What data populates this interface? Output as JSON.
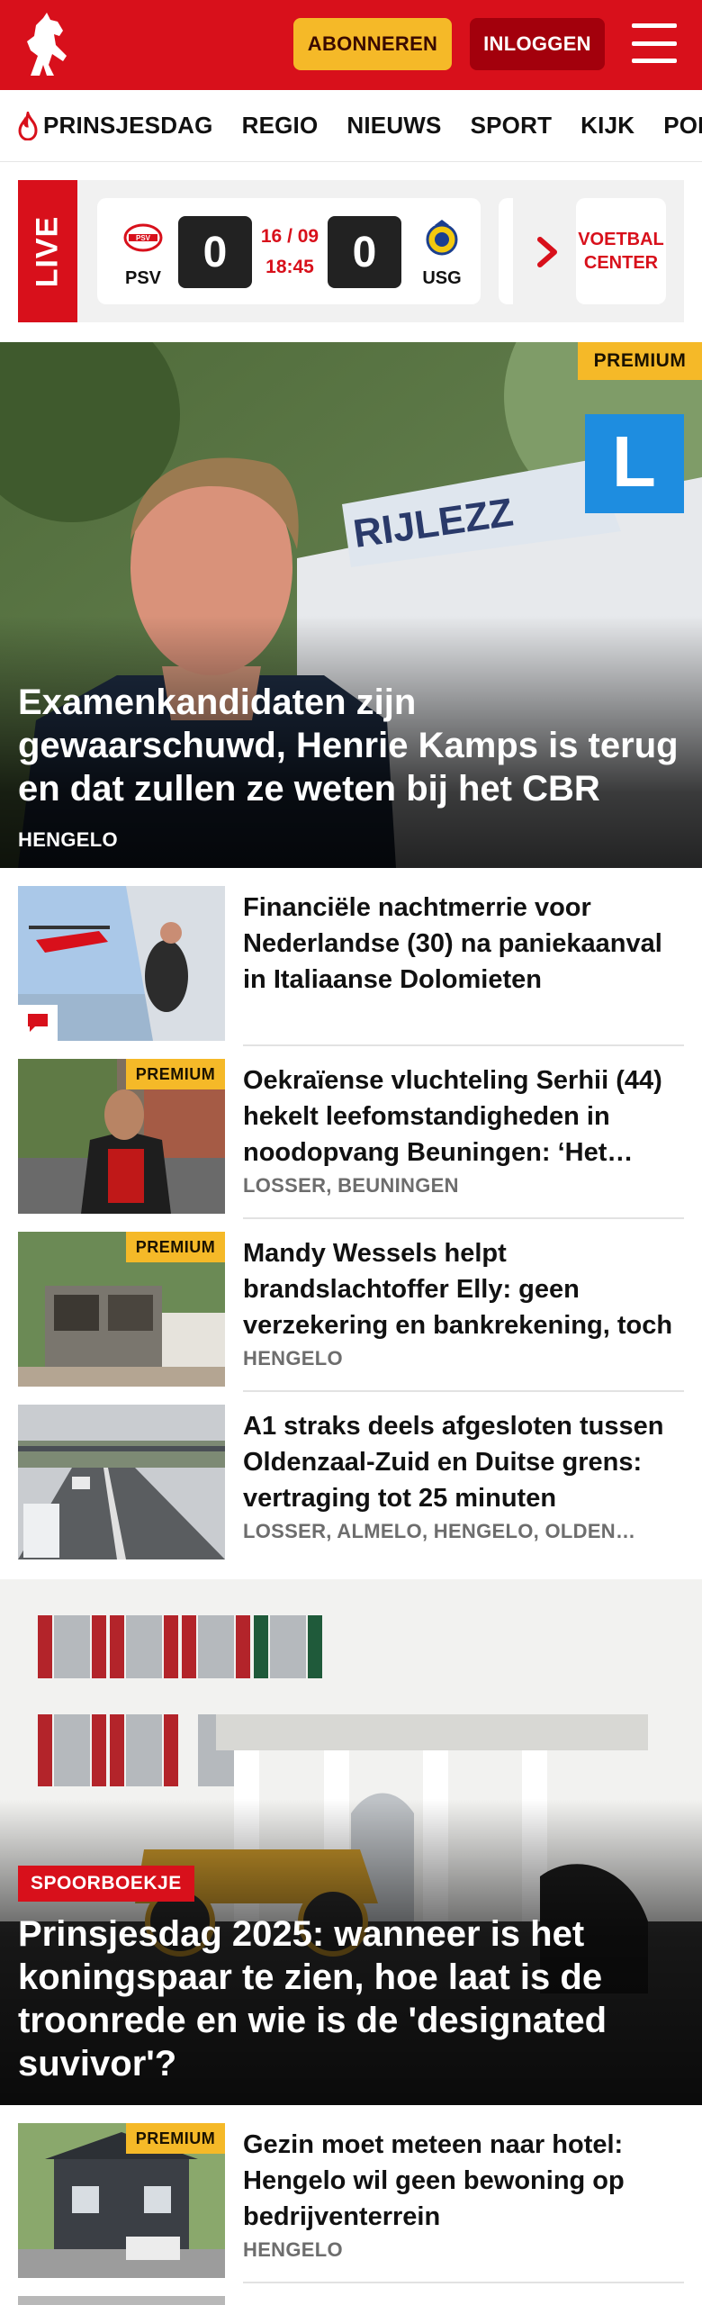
{
  "header": {
    "subscribe_label": "ABONNEREN",
    "login_label": "INLOGGEN"
  },
  "nav": {
    "items": [
      "PRINSJESDAG",
      "REGIO",
      "NIEUWS",
      "SPORT",
      "KIJK",
      "PODCA"
    ]
  },
  "live": {
    "tag": "LIVE",
    "home_team": "PSV",
    "away_team": "USG",
    "home_score": "0",
    "away_score": "0",
    "date": "16 / 09",
    "time": "18:45",
    "voetbal_center": "VOETBAL CENTER"
  },
  "hero": {
    "badge": "PREMIUM",
    "title": "Examenkandidaten zijn gewaarschuwd, Henrie Kamps is terug en dat zullen ze weten bij het CBR",
    "location": "HENGELO",
    "sign_text": "RIJLEZZ"
  },
  "articles": [
    {
      "title": "Financiële nachtmerrie voor Nederlandse (30) na paniekaanval in Italiaanse Dolomieten",
      "location": "",
      "premium": false,
      "comment_icon": true
    },
    {
      "title": "Oekraïense vluchteling Serhii (44) hekelt leefomstandigheden in noodopvang Beuningen: ‘Het…",
      "location": "LOSSER, BEUNINGEN",
      "premium": true,
      "premium_label": "PREMIUM"
    },
    {
      "title": "Mandy Wessels helpt brandslachtoffer Elly: geen verzekering en bankrekening, toch hoo…",
      "location": "HENGELO",
      "premium": true,
      "premium_label": "PREMIUM"
    },
    {
      "title": "A1 straks deels afgesloten tussen Oldenzaal-Zuid en Duitse grens: vertraging tot 25 minuten",
      "location": "LOSSER, ALMELO, HENGELO, OLDEN…",
      "premium": false
    }
  ],
  "hero2": {
    "tag": "SPOORBOEKJE",
    "title": "Prinsjesdag 2025: wanneer is het koningspaar te zien, hoe laat is de troonrede en wie is de 'designated suvivor'?"
  },
  "articles2": [
    {
      "title": "Gezin moet meteen naar hotel: Hengelo wil geen bewoning op bedrijventerrein",
      "location": "HENGELO",
      "premium": true,
      "premium_label": "PREMIUM"
    }
  ],
  "colors": {
    "brand_red": "#d8101b",
    "dark_red": "#a3000c",
    "premium_yellow": "#f5b928"
  }
}
